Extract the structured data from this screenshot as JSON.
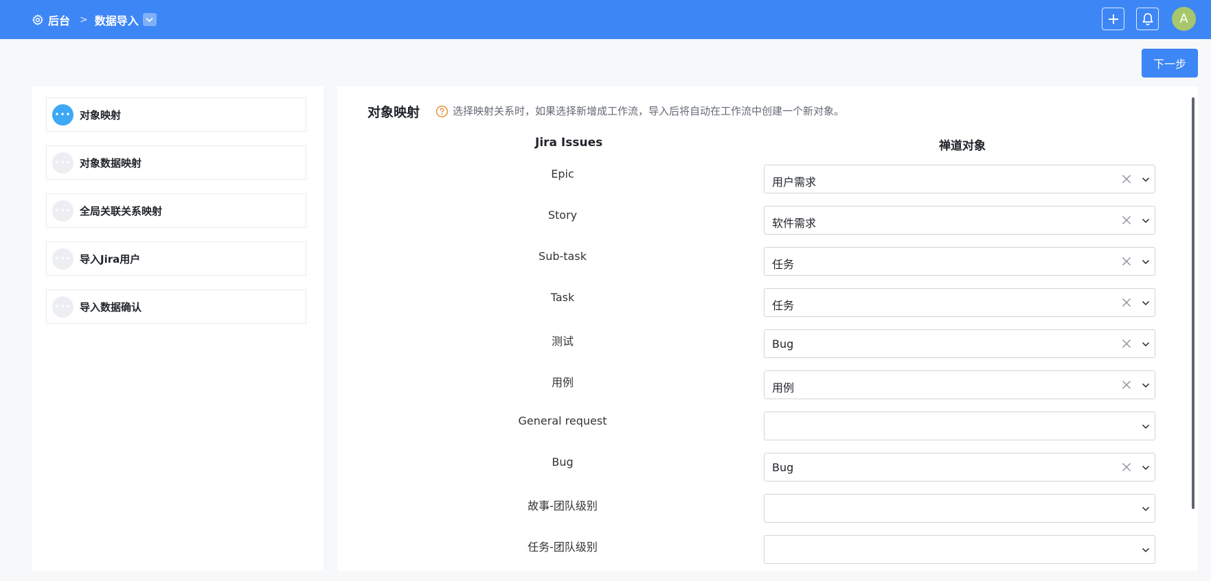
{
  "breadcrumb": {
    "home": "后台",
    "current": "数据导入"
  },
  "toolbar": {
    "next_label": "下一步",
    "avatar_letter": "A"
  },
  "steps": [
    {
      "label": "对象映射",
      "active": true
    },
    {
      "label": "对象数据映射",
      "active": false
    },
    {
      "label": "全局关联关系映射",
      "active": false
    },
    {
      "label": "导入Jira用户",
      "active": false
    },
    {
      "label": "导入数据确认",
      "active": false
    }
  ],
  "main": {
    "title": "对象映射",
    "hint": "选择映射关系时，如果选择新增成工作流，导入后将自动在工作流中创建一个新对象。",
    "col_left": "Jira Issues",
    "col_right": "禅道对象",
    "rows": [
      {
        "jira": "Epic",
        "target": "用户需求"
      },
      {
        "jira": "Story",
        "target": "软件需求"
      },
      {
        "jira": "Sub-task",
        "target": "任务"
      },
      {
        "jira": "Task",
        "target": "任务"
      },
      {
        "jira": "测试",
        "target": "Bug"
      },
      {
        "jira": "用例",
        "target": "用例"
      },
      {
        "jira": "General request",
        "target": ""
      },
      {
        "jira": "Bug",
        "target": "Bug"
      },
      {
        "jira": "故事-团队级别",
        "target": ""
      },
      {
        "jira": "任务-团队级别",
        "target": ""
      }
    ]
  },
  "icons": {
    "breadcrumb": "gear-icon",
    "dropdown": "chevron-down-icon",
    "add": "plus-icon",
    "notify": "bell-icon",
    "help": "question-circle-icon",
    "clear": "close-icon",
    "step": "ellipsis-icon"
  },
  "colors": {
    "topbar": "#3d86f5",
    "active_step": "#3da8f5",
    "hint_icon": "#e6963a"
  }
}
